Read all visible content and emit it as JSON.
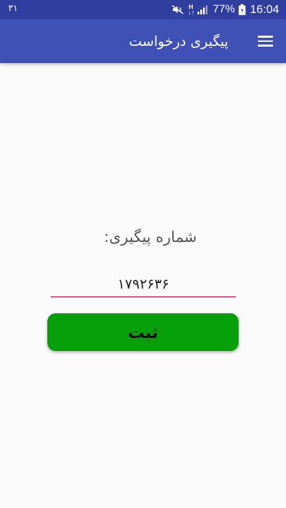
{
  "status_bar": {
    "notification": "۳۱",
    "network": "H",
    "battery": "77%",
    "time": "16:04",
    "icons": [
      "mute-icon",
      "network-type-icon",
      "signal-icon",
      "battery-icon"
    ]
  },
  "app_bar": {
    "title": "پیگیری درخواست",
    "menu_icon": "menu-icon",
    "color": "#3f51b5"
  },
  "form": {
    "label": "شماره پیگیری:",
    "tracking_number": "۱۷۹۲۶۳۶",
    "submit_label": "ثبت",
    "submit_color": "#08a00a",
    "underline_color": "#e94c7a"
  }
}
